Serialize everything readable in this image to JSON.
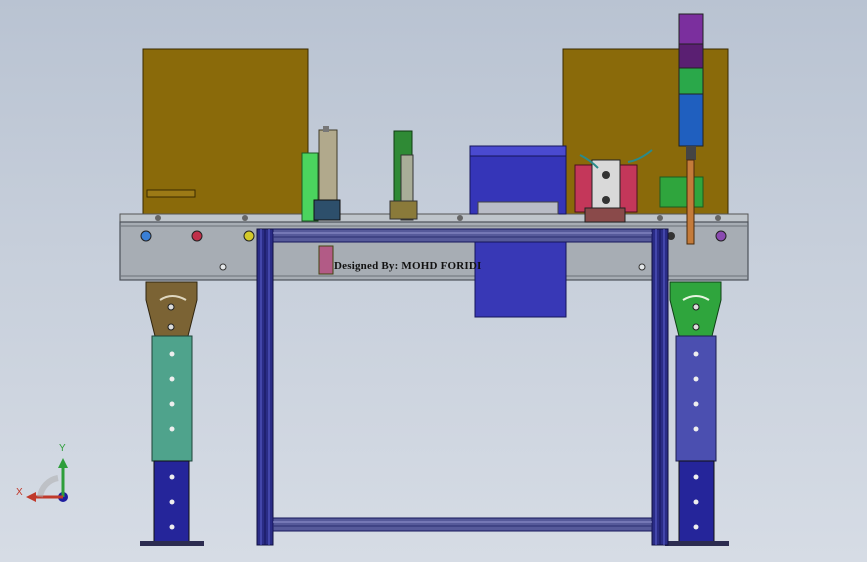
{
  "viewport": {
    "designed_by_text": "Designed By: MOHD FORIDI",
    "triad": {
      "x_label": "X",
      "y_label": "Y"
    }
  },
  "colors": {
    "background_top": "#b9c3d2",
    "control_box": "#8a6a0a",
    "frame_gray": "#a7adb4",
    "profile_blue": "#2a2c86",
    "leg_teal": "#4fa38c",
    "leg_purple": "#4b4fb0",
    "bracket_brown": "#7b6334",
    "bracket_green": "#2fa53d",
    "conveyor_blue": "#3535b8",
    "signal_purple": "#7b2f9e",
    "signal_green": "#2aa84a",
    "signal_blue": "#1f5fbf",
    "fixture_red": "#c4375a",
    "green_cylinder": "#4bd45e"
  },
  "icons": [
    "axis-triad-icon"
  ]
}
